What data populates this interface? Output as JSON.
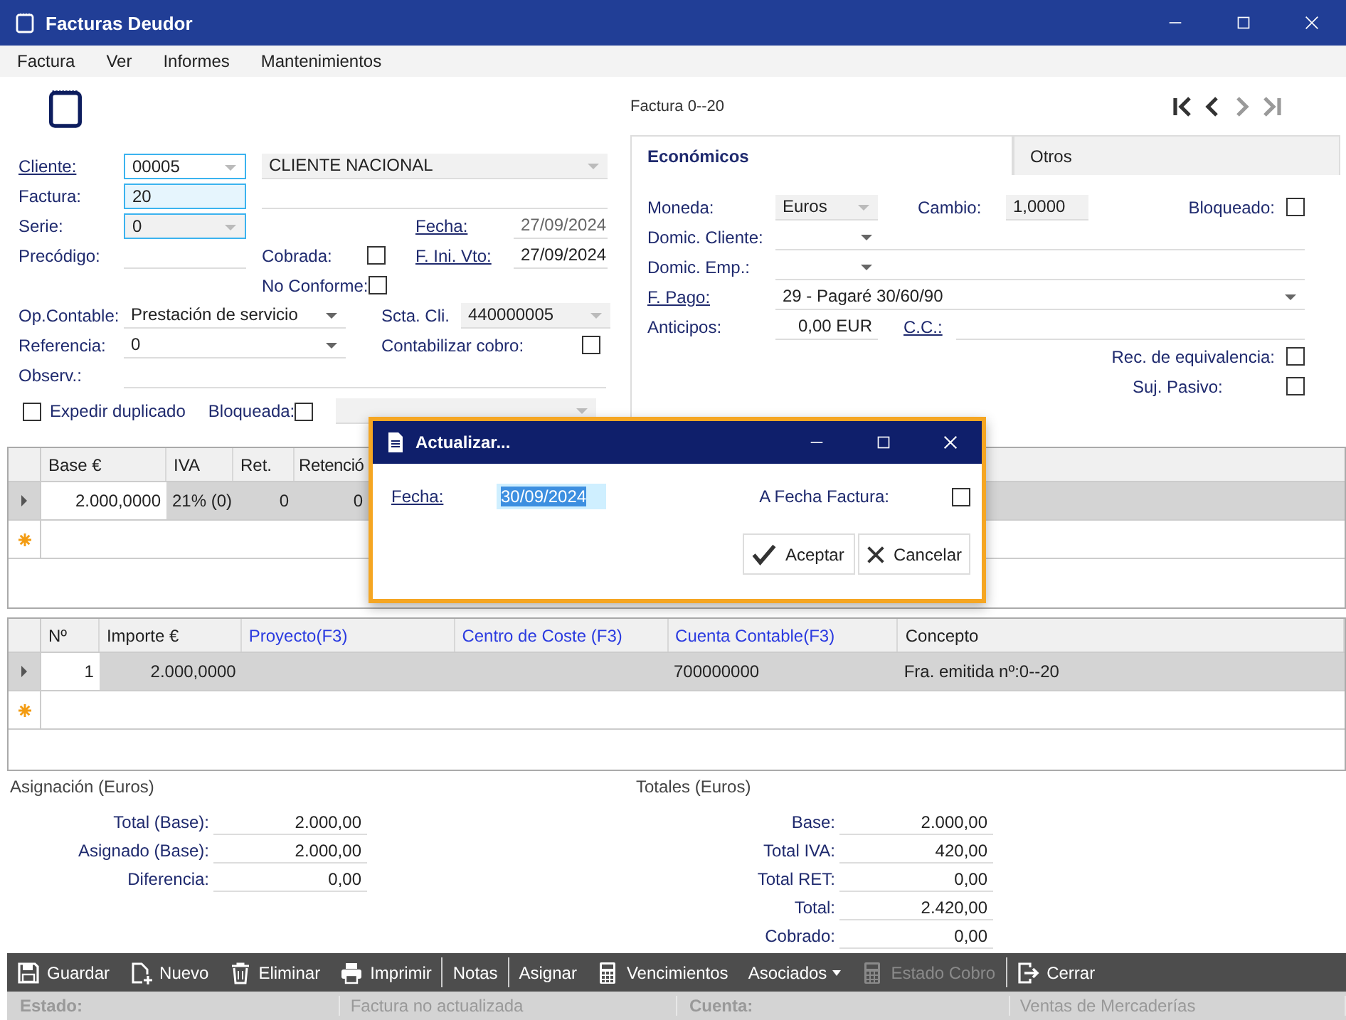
{
  "window": {
    "title": "Facturas Deudor"
  },
  "menu": [
    "Factura",
    "Ver",
    "Informes",
    "Mantenimientos"
  ],
  "record_label": "Factura 0--20",
  "nav": [
    {
      "kind": "first",
      "disabled": false
    },
    {
      "kind": "prev",
      "disabled": false
    },
    {
      "kind": "next",
      "disabled": true
    },
    {
      "kind": "last",
      "disabled": true
    }
  ],
  "header": {
    "cliente": {
      "label": "Cliente:",
      "code": "00005",
      "name": "CLIENTE NACIONAL"
    },
    "factura": {
      "label": "Factura:",
      "value": "20"
    },
    "serie": {
      "label": "Serie:",
      "value": "0"
    },
    "fecha": {
      "label": "Fecha:",
      "value": "27/09/2024"
    },
    "precodigo": {
      "label": "Precódigo:"
    },
    "cobrada": {
      "label": "Cobrada:",
      "checked": false
    },
    "f_ini_vto": {
      "label": "F. Ini. Vto:",
      "value": "27/09/2024"
    },
    "no_conforme": {
      "label": "No Conforme:",
      "checked": false
    },
    "op_contable": {
      "label": "Op.Contable:",
      "value": "Prestación de servicio"
    },
    "scta_cli": {
      "label": "Scta. Cli.",
      "value": "440000005"
    },
    "referencia": {
      "label": "Referencia:",
      "value": "0"
    },
    "contabilizar": {
      "label": "Contabilizar cobro:",
      "checked": false
    },
    "observ": {
      "label": "Observ.:"
    },
    "expedir": {
      "label": "Expedir duplicado",
      "checked": false
    },
    "bloqueada": {
      "label": "Bloqueada:",
      "checked": false
    }
  },
  "tabs": [
    {
      "label": "Económicos",
      "selected": true
    },
    {
      "label": "Otros",
      "selected": false
    }
  ],
  "economicos": {
    "moneda": {
      "label": "Moneda:",
      "value": "Euros"
    },
    "cambio": {
      "label": "Cambio:",
      "value": "1,0000"
    },
    "bloqueado": {
      "label": "Bloqueado:",
      "checked": false
    },
    "domic_cliente": {
      "label": "Domic. Cliente:"
    },
    "domic_emp": {
      "label": "Domic. Emp.:"
    },
    "f_pago": {
      "label": "F. Pago:",
      "value": "29 - Pagaré 30/60/90"
    },
    "anticipos": {
      "label": "Anticipos:",
      "value": "0,00 EUR"
    },
    "cc": {
      "label": "C.C.:"
    },
    "rec_equiv": {
      "label": "Rec. de equivalencia:",
      "checked": false
    },
    "suj_pasivo": {
      "label": "Suj. Pasivo:",
      "checked": false
    }
  },
  "tax_grid": {
    "columns": [
      "Base €",
      "IVA",
      "Ret.",
      "Retenció"
    ],
    "rows": [
      {
        "cells": [
          "2.000,0000",
          "21% (0)",
          "0",
          "0"
        ]
      }
    ]
  },
  "lines_grid": {
    "columns": [
      {
        "label": "Nº",
        "lookup": false
      },
      {
        "label": "Importe €",
        "lookup": false
      },
      {
        "label": "Proyecto(F3)",
        "lookup": true
      },
      {
        "label": "Centro de Coste (F3)",
        "lookup": true
      },
      {
        "label": "Cuenta Contable(F3)",
        "lookup": true
      },
      {
        "label": "Concepto",
        "lookup": false
      }
    ],
    "rows": [
      {
        "n": "1",
        "importe": "2.000,0000",
        "cuenta": "700000000",
        "concepto": "Fra. emitida nº:0--20"
      }
    ]
  },
  "asignacion": {
    "title": "Asignación (Euros)",
    "rows": [
      {
        "label": "Total (Base):",
        "value": "2.000,00"
      },
      {
        "label": "Asignado (Base):",
        "value": "2.000,00"
      },
      {
        "label": "Diferencia:",
        "value": "0,00"
      }
    ]
  },
  "totales": {
    "title": "Totales (Euros)",
    "rows": [
      {
        "label": "Base:",
        "value": "2.000,00"
      },
      {
        "label": "Total IVA:",
        "value": "420,00"
      },
      {
        "label": "Total RET:",
        "value": "0,00"
      },
      {
        "label": "Total:",
        "value": "2.420,00"
      },
      {
        "label": "Cobrado:",
        "value": "0,00"
      }
    ]
  },
  "toolbar": [
    {
      "kind": "save",
      "label": "Guardar",
      "disabled": false
    },
    {
      "kind": "new",
      "label": "Nuevo",
      "disabled": false
    },
    {
      "kind": "delete",
      "label": "Eliminar",
      "disabled": false
    },
    {
      "kind": "print",
      "label": "Imprimir",
      "disabled": false
    },
    {
      "kind": "separator"
    },
    {
      "kind": "text",
      "label": "Notas",
      "disabled": false
    },
    {
      "kind": "separator"
    },
    {
      "kind": "text",
      "label": "Asignar",
      "disabled": false
    },
    {
      "kind": "calculator",
      "label": "Vencimientos",
      "disabled": false
    },
    {
      "kind": "dropdown",
      "label": "Asociados",
      "disabled": false
    },
    {
      "kind": "calculator",
      "label": "Estado Cobro",
      "disabled": true
    },
    {
      "kind": "separator"
    },
    {
      "kind": "exit",
      "label": "Cerrar",
      "disabled": false
    }
  ],
  "status": [
    {
      "label": "Estado:",
      "value": "Factura no actualizada"
    },
    {
      "label": "Cuenta:",
      "value": "Ventas de Mercaderías"
    }
  ],
  "dialog": {
    "title": "Actualizar...",
    "fecha_label": "Fecha:",
    "fecha_value": "30/09/2024",
    "a_fecha": {
      "label": "A Fecha Factura:",
      "checked": false
    },
    "buttons": [
      {
        "kind": "ok",
        "label": "Aceptar"
      },
      {
        "kind": "cancel",
        "label": "Cancelar"
      }
    ]
  }
}
